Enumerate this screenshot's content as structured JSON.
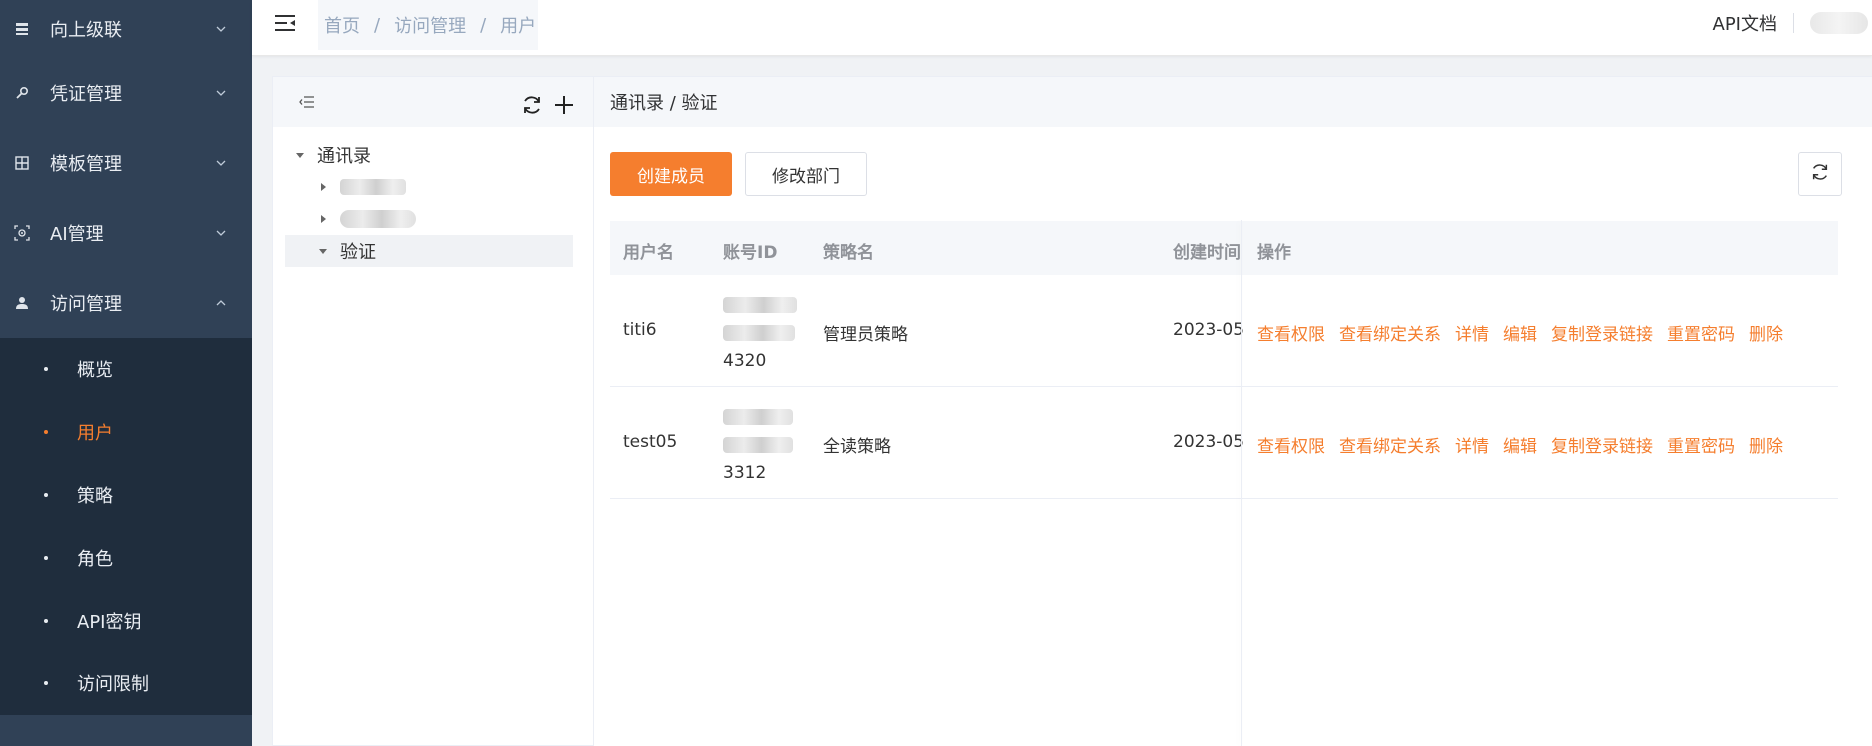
{
  "sidebar": {
    "menu": [
      {
        "label": "向上级联",
        "icon": "list-icon"
      },
      {
        "label": "凭证管理",
        "icon": "key-icon"
      },
      {
        "label": "模板管理",
        "icon": "grid-icon"
      },
      {
        "label": "AI管理",
        "icon": "ai-icon"
      },
      {
        "label": "访问管理",
        "icon": "user-icon"
      }
    ],
    "submenu": [
      {
        "label": "概览"
      },
      {
        "label": "用户"
      },
      {
        "label": "策略"
      },
      {
        "label": "角色"
      },
      {
        "label": "API密钥"
      },
      {
        "label": "访问限制"
      }
    ],
    "active_submenu": "用户",
    "accent_color": "#f57e2e"
  },
  "topbar": {
    "breadcrumb": [
      "首页",
      "访问管理",
      "用户"
    ],
    "separator": "/",
    "api_doc": "API文档"
  },
  "tree": {
    "root": "通讯录",
    "selected": "验证"
  },
  "content": {
    "path": "通讯录 / 验证",
    "create_button": "创建成员",
    "edit_dept_button": "修改部门"
  },
  "table": {
    "columns": [
      "用户名",
      "账号ID",
      "策略名",
      "创建时间",
      "操作"
    ],
    "rows": [
      {
        "username": "titi6",
        "account_id_tail": "4320",
        "policy": "管理员策略",
        "created": "2023-05"
      },
      {
        "username": "test05",
        "account_id_tail": "3312",
        "policy": "全读策略",
        "created": "2023-05"
      }
    ],
    "operations": [
      "查看权限",
      "查看绑定关系",
      "详情",
      "编辑",
      "复制登录链接",
      "重置密码",
      "删除"
    ]
  }
}
